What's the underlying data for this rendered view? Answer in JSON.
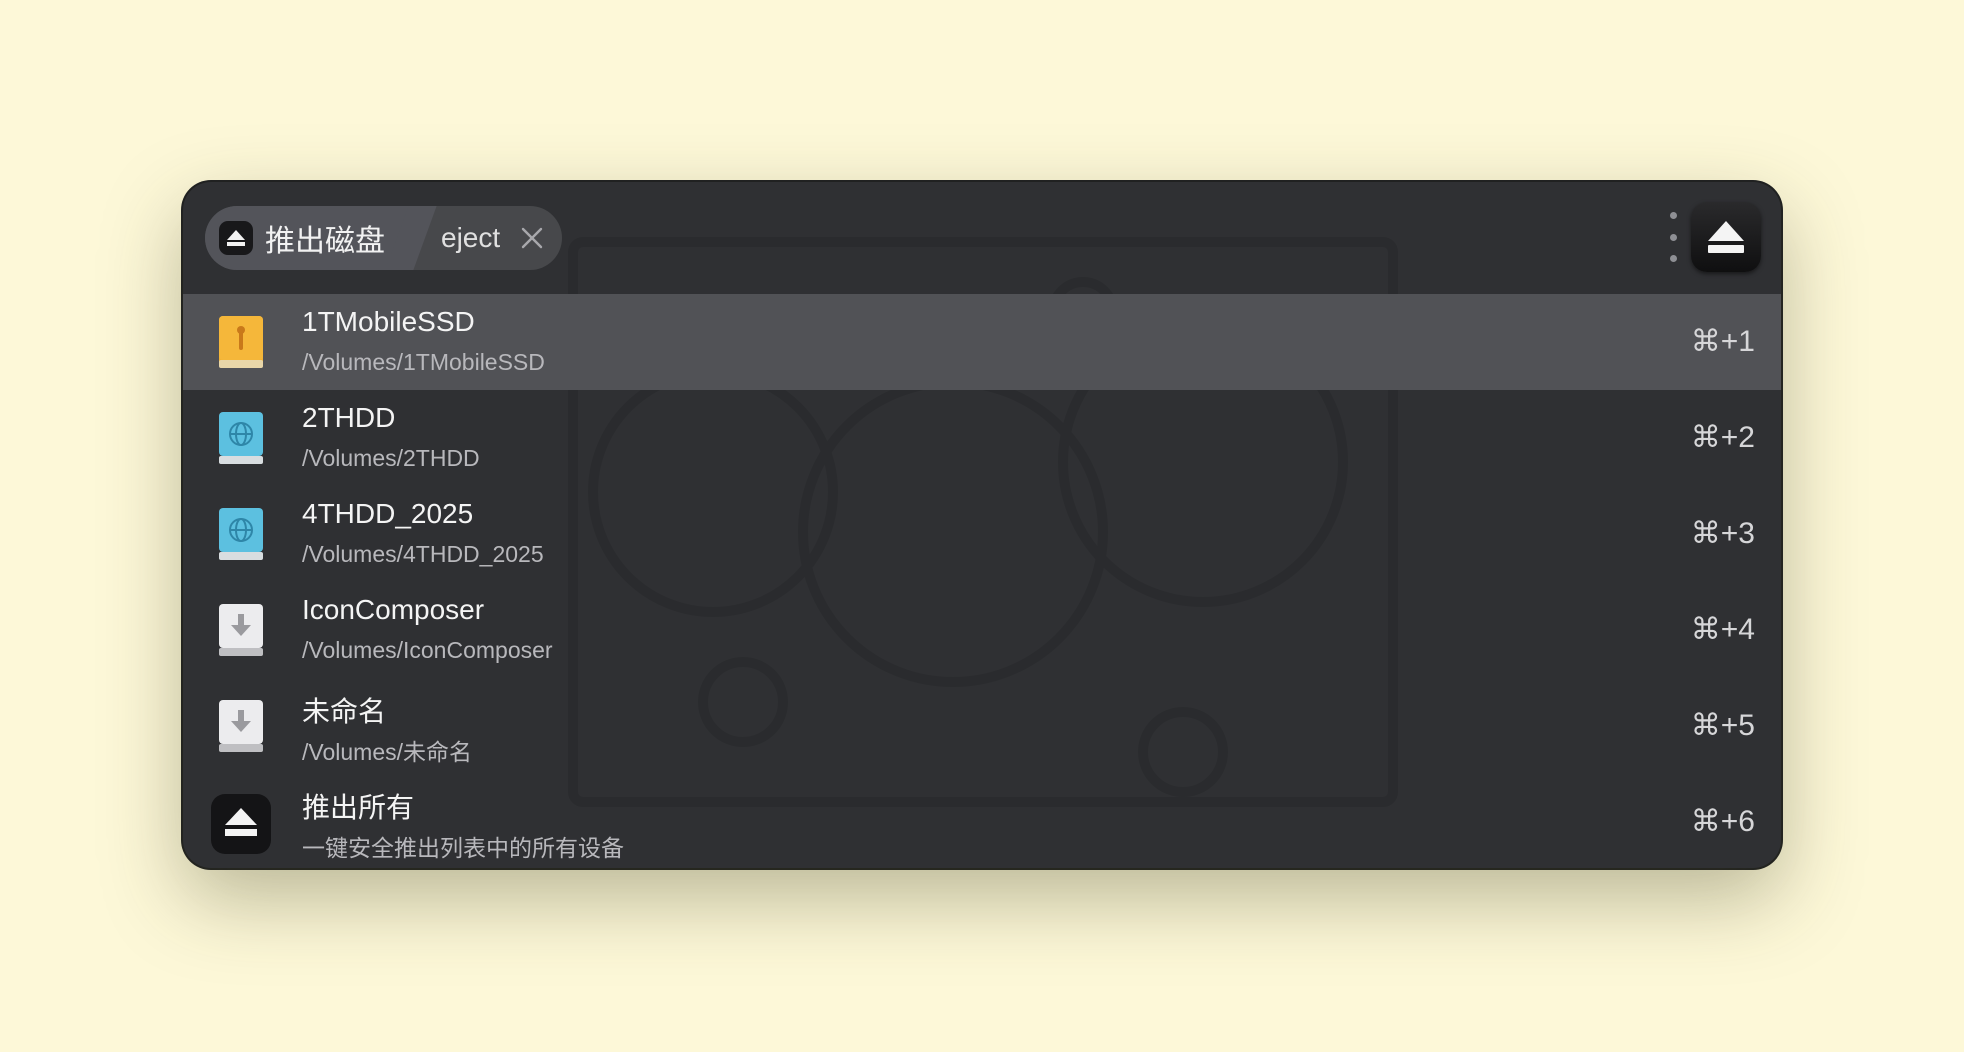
{
  "search": {
    "command_label": "推出磁盘",
    "query": "eject"
  },
  "colors": {
    "background": "#fdf8d8",
    "panel": "#2f3033",
    "selected_row": "#515256",
    "ssd_icon": "#f0b030",
    "hdd_icon": "#5fc0df"
  },
  "items": [
    {
      "title": "1TMobileSSD",
      "path": "/Volumes/1TMobileSSD",
      "shortcut": "⌘+1",
      "icon": "orange-drive-icon",
      "selected": true
    },
    {
      "title": "2THDD",
      "path": "/Volumes/2THDD",
      "shortcut": "⌘+2",
      "icon": "network-drive-icon",
      "selected": false
    },
    {
      "title": "4THDD_2025",
      "path": "/Volumes/4THDD_2025",
      "shortcut": "⌘+3",
      "icon": "network-drive-icon",
      "selected": false
    },
    {
      "title": "IconComposer",
      "path": "/Volumes/IconComposer",
      "shortcut": "⌘+4",
      "icon": "disk-image-icon",
      "selected": false
    },
    {
      "title": "未命名",
      "path": "/Volumes/未命名",
      "shortcut": "⌘+5",
      "icon": "disk-image-icon",
      "selected": false
    },
    {
      "title": "推出所有",
      "path": "一键安全推出列表中的所有设备",
      "shortcut": "⌘+6",
      "icon": "eject-icon",
      "selected": false
    }
  ]
}
